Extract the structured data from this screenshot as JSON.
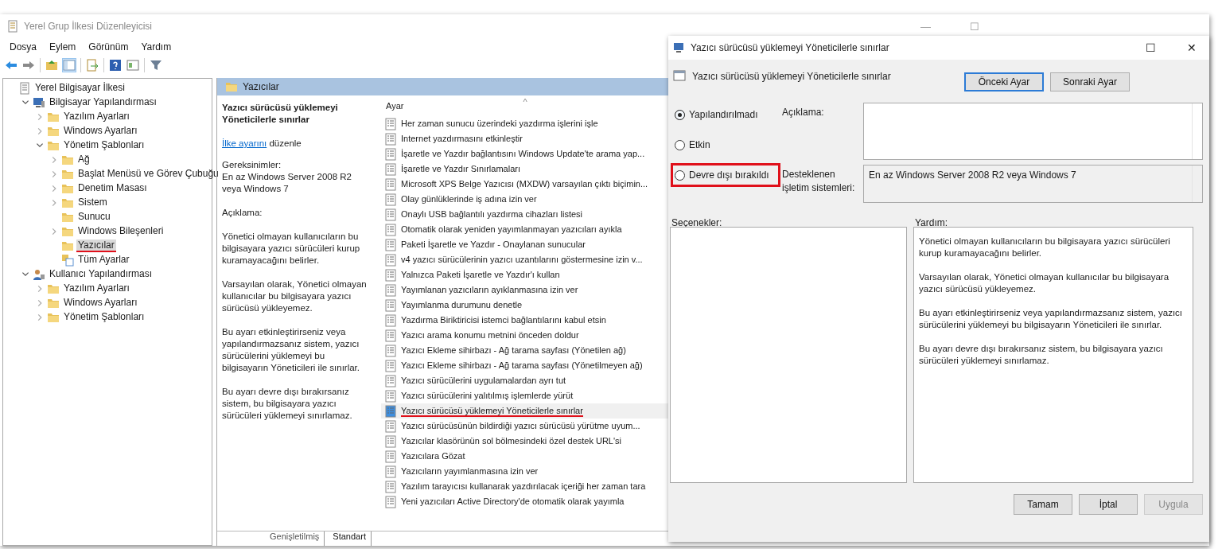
{
  "window": {
    "title": "Yerel Grup İlkesi Düzenleyicisi",
    "controls": [
      "—",
      "☐"
    ]
  },
  "menu": [
    "Dosya",
    "Eylem",
    "Görünüm",
    "Yardım"
  ],
  "tree": [
    {
      "label": "Yerel Bilgisayar İlkesi",
      "kind": "policy",
      "selected": false,
      "annotated": false,
      "children": [
        {
          "label": "Bilgisayar Yapılandırması",
          "kind": "computer",
          "expanded": true,
          "selected": false,
          "annotated": false,
          "children": [
            {
              "label": "Yazılım Ayarları",
              "kind": "folder",
              "expanded": false,
              "selected": false,
              "annotated": false
            },
            {
              "label": "Windows Ayarları",
              "kind": "folder",
              "expanded": false,
              "selected": false,
              "annotated": false
            },
            {
              "label": "Yönetim Şablonları",
              "kind": "folder",
              "expanded": true,
              "selected": false,
              "annotated": false,
              "children": [
                {
                  "label": "Ağ",
                  "kind": "folder",
                  "expanded": false,
                  "selected": false,
                  "annotated": false
                },
                {
                  "label": "Başlat Menüsü ve Görev Çubuğu",
                  "kind": "folder",
                  "expanded": false,
                  "selected": false,
                  "annotated": false
                },
                {
                  "label": "Denetim Masası",
                  "kind": "folder",
                  "expanded": false,
                  "selected": false,
                  "annotated": false
                },
                {
                  "label": "Sistem",
                  "kind": "folder",
                  "expanded": false,
                  "selected": false,
                  "annotated": false
                },
                {
                  "label": "Sunucu",
                  "kind": "folder",
                  "selected": false,
                  "annotated": false
                },
                {
                  "label": "Windows Bileşenleri",
                  "kind": "folder",
                  "expanded": false,
                  "selected": false,
                  "annotated": false
                },
                {
                  "label": "Yazıcılar",
                  "kind": "folder",
                  "selected": true,
                  "annotated": true
                },
                {
                  "label": "Tüm Ayarlar",
                  "kind": "all",
                  "selected": false,
                  "annotated": false
                }
              ]
            }
          ]
        },
        {
          "label": "Kullanıcı Yapılandırması",
          "kind": "user",
          "expanded": true,
          "selected": false,
          "annotated": false,
          "children": [
            {
              "label": "Yazılım Ayarları",
              "kind": "folder",
              "expanded": false,
              "selected": false,
              "annotated": false
            },
            {
              "label": "Windows Ayarları",
              "kind": "folder",
              "expanded": false,
              "selected": false,
              "annotated": false
            },
            {
              "label": "Yönetim Şablonları",
              "kind": "folder",
              "expanded": false,
              "selected": false,
              "annotated": false
            }
          ]
        }
      ]
    }
  ],
  "panel": {
    "header": "Yazıcılar"
  },
  "details": {
    "title": "Yazıcı sürücüsü yüklemeyi Yöneticilerle sınırlar",
    "edit_link": "İlke ayarını",
    "edit_text": "düzenle",
    "requirements_label": "Gereksinimler:",
    "requirements": "En az Windows Server 2008 R2 veya Windows 7",
    "description_label": "Açıklama:",
    "paragraphs": [
      "Yönetici olmayan kullanıcıların bu bilgisayara yazıcı sürücüleri kurup kuramayacağını belirler.",
      "Varsayılan olarak, Yönetici olmayan kullanıcılar bu bilgisayara yazıcı sürücüsü yükleyemez.",
      "Bu ayarı etkinleştirirseniz veya yapılandırmazsanız sistem, yazıcı sürücülerini yüklemeyi bu bilgisayarın Yöneticileri ile sınırlar.",
      "Bu ayarı devre dışı bırakırsanız sistem, bu bilgisayara yazıcı sürücüleri yüklemeyi sınırlamaz."
    ]
  },
  "settings": {
    "column": "Ayar",
    "sort_mark": "^",
    "rows": [
      {
        "label": "Her zaman sunucu üzerindeki yazdırma işlerini işle",
        "selected": false,
        "annotated": false
      },
      {
        "label": "Internet yazdırmasını etkinleştir",
        "selected": false,
        "annotated": false
      },
      {
        "label": "İşaretle ve Yazdır bağlantısını Windows Update'te arama yap...",
        "selected": false,
        "annotated": false
      },
      {
        "label": "İşaretle ve Yazdır Sınırlamaları",
        "selected": false,
        "annotated": false
      },
      {
        "label": "Microsoft XPS Belge Yazıcısı (MXDW) varsayılan çıktı biçimin...",
        "selected": false,
        "annotated": false
      },
      {
        "label": "Olay günlüklerinde iş adına izin ver",
        "selected": false,
        "annotated": false
      },
      {
        "label": "Onaylı USB bağlantılı yazdırma cihazları listesi",
        "selected": false,
        "annotated": false
      },
      {
        "label": "Otomatik olarak yeniden yayımlanmayan yazıcıları ayıkla",
        "selected": false,
        "annotated": false
      },
      {
        "label": "Paketi İşaretle ve Yazdır - Onaylanan sunucular",
        "selected": false,
        "annotated": false
      },
      {
        "label": "v4 yazıcı sürücülerinin yazıcı uzantılarını göstermesine izin v...",
        "selected": false,
        "annotated": false
      },
      {
        "label": "Yalnızca Paketi İşaretle ve Yazdır'ı kullan",
        "selected": false,
        "annotated": false
      },
      {
        "label": "Yayımlanan yazıcıların ayıklanmasına izin ver",
        "selected": false,
        "annotated": false
      },
      {
        "label": "Yayımlanma durumunu denetle",
        "selected": false,
        "annotated": false
      },
      {
        "label": "Yazdırma Biriktiricisi istemci bağlantılarını kabul etsin",
        "selected": false,
        "annotated": false
      },
      {
        "label": "Yazıcı arama konumu metnini önceden doldur",
        "selected": false,
        "annotated": false
      },
      {
        "label": "Yazıcı Ekleme sihirbazı - Ağ tarama sayfası (Yönetilen ağ)",
        "selected": false,
        "annotated": false
      },
      {
        "label": "Yazıcı Ekleme sihirbazı - Ağ tarama sayfası (Yönetilmeyen ağ)",
        "selected": false,
        "annotated": false
      },
      {
        "label": "Yazıcı sürücülerini uygulamalardan ayrı tut",
        "selected": false,
        "annotated": false
      },
      {
        "label": "Yazıcı sürücülerini yalıtılmış işlemlerde yürüt",
        "selected": false,
        "annotated": false
      },
      {
        "label": "Yazıcı sürücüsü yüklemeyi Yöneticilerle sınırlar",
        "selected": true,
        "annotated": true
      },
      {
        "label": "Yazıcı sürücüsünün bildirdiği yazıcı sürücüsü yürütme uyum...",
        "selected": false,
        "annotated": false
      },
      {
        "label": "Yazıcılar klasörünün sol bölmesindeki özel destek URL'si",
        "selected": false,
        "annotated": false
      },
      {
        "label": "Yazıcılara Gözat",
        "selected": false,
        "annotated": false
      },
      {
        "label": "Yazıcıların yayımlanmasına izin ver",
        "selected": false,
        "annotated": false
      },
      {
        "label": "Yazılım tarayıcısı kullanarak yazdırılacak içeriği her zaman tara",
        "selected": false,
        "annotated": false
      },
      {
        "label": "Yeni yazıcıları Active Directory'de otomatik olarak yayımla",
        "selected": false,
        "annotated": false
      }
    ]
  },
  "view_tabs": [
    {
      "label": "Genişletilmiş",
      "selected": false
    },
    {
      "label": "Standart",
      "selected": true
    }
  ],
  "dialog": {
    "title": "Yazıcı sürücüsü yüklemeyi Yöneticilerle sınırlar",
    "controls": [
      "☐",
      "✕"
    ],
    "setting": "Yazıcı sürücüsü yüklemeyi Yöneticilerle sınırlar",
    "nav_buttons": [
      {
        "label": "Önceki Ayar",
        "focused": true
      },
      {
        "label": "Sonraki Ayar",
        "focused": false
      }
    ],
    "options": [
      {
        "label": "Yapılandırılmadı",
        "selected": true,
        "annotated": false
      },
      {
        "label": "Etkin",
        "selected": false,
        "annotated": false
      },
      {
        "label": "Devre dışı bırakıldı",
        "selected": false,
        "annotated": true
      }
    ],
    "comment_label": "Açıklama:",
    "supported_label": "Desteklenen işletim sistemleri:",
    "supported": "En az Windows Server 2008 R2 veya Windows 7",
    "options_label": "Seçenekler:",
    "help_label": "Yardım:",
    "help": [
      "Yönetici olmayan kullanıcıların bu bilgisayara yazıcı sürücüleri kurup kuramayacağını belirler.",
      "Varsayılan olarak, Yönetici olmayan kullanıcılar bu bilgisayara yazıcı sürücüsü yükleyemez.",
      "Bu ayarı etkinleştirirseniz veya yapılandırmazsanız sistem, yazıcı sürücülerini yüklemeyi bu bilgisayarın Yöneticileri ile sınırlar.",
      "Bu ayarı devre dışı bırakırsanız sistem, bu bilgisayara yazıcı sürücüleri yüklemeyi sınırlamaz."
    ],
    "buttons": [
      {
        "label": "Tamam",
        "disabled": false
      },
      {
        "label": "İptal",
        "disabled": false
      },
      {
        "label": "Uygula",
        "disabled": true
      }
    ]
  }
}
